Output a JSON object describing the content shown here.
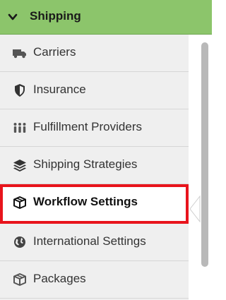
{
  "header": {
    "title": "Shipping",
    "icon": "chevron-down-icon",
    "background": "#8cc56b"
  },
  "menu": {
    "items": [
      {
        "label": "Carriers",
        "icon": "truck-icon"
      },
      {
        "label": "Insurance",
        "icon": "shield-icon"
      },
      {
        "label": "Fulfillment Providers",
        "icon": "people-icon"
      },
      {
        "label": "Shipping Strategies",
        "icon": "layers-icon"
      },
      {
        "label": "Workflow Settings",
        "icon": "box-icon",
        "active": true
      },
      {
        "label": "International Settings",
        "icon": "globe-icon"
      },
      {
        "label": "Packages",
        "icon": "box-icon"
      }
    ]
  },
  "highlight_color": "#e8141c"
}
